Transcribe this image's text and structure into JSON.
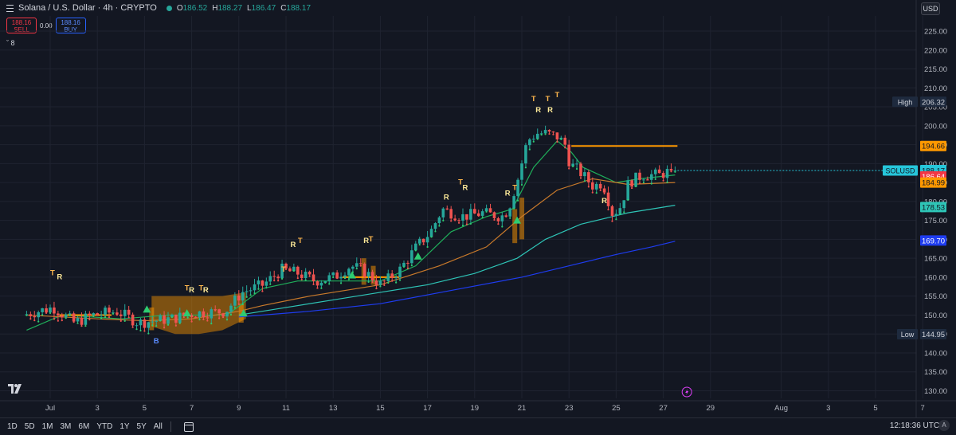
{
  "header": {
    "title": "Solana / U.S. Dollar · 4h · CRYPTO",
    "ohlc": [
      {
        "k": "O",
        "v": "186.52"
      },
      {
        "k": "H",
        "v": "188.27"
      },
      {
        "k": "L",
        "v": "186.47"
      },
      {
        "k": "C",
        "v": "188.17"
      }
    ]
  },
  "trade": {
    "sell_price": "188.16",
    "sell_label": "SELL",
    "spread": "0.00",
    "buy_price": "188.16",
    "buy_label": "BUY"
  },
  "indicator_toggle": "8",
  "currency": "USD",
  "bottombar": {
    "timeframes": [
      "1D",
      "5D",
      "1M",
      "3M",
      "6M",
      "YTD",
      "1Y",
      "5Y",
      "All"
    ],
    "clock": "12:18:36 UTC-4"
  },
  "colors": {
    "background": "#131722",
    "up": "#26a69a",
    "down": "#ef5350",
    "orange": "#ff9800",
    "teal_ma": "#2ec4b6",
    "blue_ma": "#1e3cf0",
    "green_ma": "#1fae5a",
    "highlight_green": "#2ecc71"
  },
  "chart_data": {
    "type": "candlestick",
    "yticks": [
      130,
      135,
      140,
      145,
      150,
      155,
      160,
      165,
      170,
      175,
      180,
      185,
      190,
      195,
      200,
      205,
      210,
      215,
      220,
      225
    ],
    "ylim": [
      128,
      229
    ],
    "xlim": [
      0,
      40
    ],
    "xticks": [
      {
        "label": "Jul",
        "day": 1
      },
      {
        "label": "3",
        "day": 3
      },
      {
        "label": "5",
        "day": 5
      },
      {
        "label": "7",
        "day": 7
      },
      {
        "label": "9",
        "day": 9
      },
      {
        "label": "11",
        "day": 11
      },
      {
        "label": "13",
        "day": 13
      },
      {
        "label": "15",
        "day": 15
      },
      {
        "label": "17",
        "day": 17
      },
      {
        "label": "19",
        "day": 19
      },
      {
        "label": "21",
        "day": 21
      },
      {
        "label": "23",
        "day": 23
      },
      {
        "label": "25",
        "day": 25
      },
      {
        "label": "27",
        "day": 27
      },
      {
        "label": "29",
        "day": 29
      },
      {
        "label": "Aug",
        "day": 32
      },
      {
        "label": "3",
        "day": 34
      },
      {
        "label": "5",
        "day": 36
      },
      {
        "label": "7",
        "day": 38
      }
    ],
    "price_keys": [
      [
        0,
        150
      ],
      [
        1.3,
        152
      ],
      [
        2.2,
        148
      ],
      [
        3,
        150
      ],
      [
        4,
        151
      ],
      [
        4.9,
        148
      ],
      [
        6.3,
        149
      ],
      [
        7.3,
        150.5
      ],
      [
        8.6,
        151
      ],
      [
        9.3,
        156
      ],
      [
        10.2,
        158
      ],
      [
        11,
        162
      ],
      [
        11.7,
        161
      ],
      [
        12.4,
        159
      ],
      [
        13.2,
        160
      ],
      [
        13.9,
        163
      ],
      [
        14.4,
        162
      ],
      [
        15.2,
        158
      ],
      [
        16,
        162
      ],
      [
        16.7,
        168
      ],
      [
        17.3,
        172
      ],
      [
        17.8,
        178
      ],
      [
        18.6,
        176
      ],
      [
        19.5,
        177
      ],
      [
        20.3,
        176
      ],
      [
        20.6,
        178
      ],
      [
        21,
        186
      ],
      [
        21.4,
        196
      ],
      [
        21.8,
        198
      ],
      [
        22.2,
        198
      ],
      [
        22.7,
        197
      ],
      [
        23,
        195
      ],
      [
        23.2,
        190
      ],
      [
        23.6,
        188
      ],
      [
        24.2,
        184
      ],
      [
        24.6,
        185
      ],
      [
        25,
        177
      ],
      [
        25.3,
        178
      ],
      [
        25.7,
        185
      ],
      [
        26.3,
        187
      ],
      [
        27,
        187
      ],
      [
        27.5,
        188.17
      ]
    ],
    "series_ma": [
      {
        "name": "ma-green",
        "points": [
          [
            0,
            146
          ],
          [
            1.5,
            150
          ],
          [
            4,
            149
          ],
          [
            6,
            150
          ],
          [
            8.5,
            150
          ],
          [
            10,
            157
          ],
          [
            11.5,
            159
          ],
          [
            13,
            159
          ],
          [
            15,
            159
          ],
          [
            16.5,
            163
          ],
          [
            18,
            172
          ],
          [
            19.5,
            176
          ],
          [
            20.6,
            178
          ],
          [
            21.5,
            189
          ],
          [
            22.5,
            196
          ],
          [
            23.1,
            193
          ],
          [
            23.6,
            189
          ],
          [
            24.3,
            187
          ],
          [
            25,
            185
          ],
          [
            26,
            186
          ],
          [
            27.5,
            187
          ]
        ]
      },
      {
        "name": "ma-orange",
        "points": [
          [
            0,
            150
          ],
          [
            3,
            149
          ],
          [
            5,
            148.5
          ],
          [
            7,
            149
          ],
          [
            9,
            151
          ],
          [
            10,
            152.5
          ],
          [
            12,
            155
          ],
          [
            15,
            158
          ],
          [
            17.5,
            163
          ],
          [
            19.5,
            168
          ],
          [
            21,
            176
          ],
          [
            22.5,
            183
          ],
          [
            24,
            186
          ],
          [
            25.5,
            184.5
          ],
          [
            27.5,
            185
          ]
        ]
      },
      {
        "name": "ma-teal",
        "points": [
          [
            9,
            150
          ],
          [
            11,
            152
          ],
          [
            13,
            154
          ],
          [
            15,
            156
          ],
          [
            17,
            158
          ],
          [
            19,
            161
          ],
          [
            20.8,
            165
          ],
          [
            22,
            170
          ],
          [
            23.5,
            174
          ],
          [
            25.5,
            177
          ],
          [
            27.5,
            179
          ]
        ]
      },
      {
        "name": "ma-blue",
        "points": [
          [
            9,
            149.5
          ],
          [
            12,
            151
          ],
          [
            15,
            153
          ],
          [
            18,
            156.5
          ],
          [
            21,
            160
          ],
          [
            23,
            163
          ],
          [
            25,
            166
          ],
          [
            26.5,
            168
          ],
          [
            27.5,
            169.5
          ]
        ]
      }
    ],
    "hlines": [
      {
        "name": "orange-level",
        "y": 194.66,
        "x1": 23.1,
        "x2": 27.6
      },
      {
        "name": "support-level-jul",
        "y": 150,
        "x1": 1.4,
        "x2": 3.6
      },
      {
        "name": "support-level-mid",
        "y": 160,
        "x1": 13.4,
        "x2": 15.8
      }
    ],
    "cloud": {
      "x1": 5.3,
      "x2": 9.3,
      "top": [
        [
          5.3,
          155
        ],
        [
          6.3,
          155
        ],
        [
          7.3,
          155
        ],
        [
          8.3,
          155
        ],
        [
          9.3,
          156
        ]
      ],
      "bottom": [
        [
          5.3,
          147
        ],
        [
          6.3,
          145
        ],
        [
          7.3,
          145
        ],
        [
          8.3,
          146
        ],
        [
          9.3,
          149
        ]
      ]
    },
    "markers": [
      {
        "kind": "T",
        "day": 1.1,
        "price": 160.5
      },
      {
        "kind": "R",
        "day": 1.4,
        "price": 159.5
      },
      {
        "kind": "T",
        "day": 6.8,
        "price": 156.5
      },
      {
        "kind": "R",
        "day": 7.0,
        "price": 156
      },
      {
        "kind": "T",
        "day": 7.4,
        "price": 156.5
      },
      {
        "kind": "R",
        "day": 7.6,
        "price": 156
      },
      {
        "kind": "R",
        "day": 11.3,
        "price": 168
      },
      {
        "kind": "T",
        "day": 11.6,
        "price": 169
      },
      {
        "kind": "T",
        "day": 10.9,
        "price": 161.5
      },
      {
        "kind": "R",
        "day": 14.4,
        "price": 169
      },
      {
        "kind": "T",
        "day": 14.6,
        "price": 169.5
      },
      {
        "kind": "R",
        "day": 17.8,
        "price": 180.5
      },
      {
        "kind": "T",
        "day": 18.4,
        "price": 184.5
      },
      {
        "kind": "R",
        "day": 18.6,
        "price": 183
      },
      {
        "kind": "T",
        "day": 20.7,
        "price": 183
      },
      {
        "kind": "R",
        "day": 20.4,
        "price": 181.5
      },
      {
        "kind": "R",
        "day": 21.7,
        "price": 203.5
      },
      {
        "kind": "T",
        "day": 21.5,
        "price": 206.5
      },
      {
        "kind": "T",
        "day": 22.1,
        "price": 206.5
      },
      {
        "kind": "T",
        "day": 22.5,
        "price": 207.5
      },
      {
        "kind": "R",
        "day": 22.2,
        "price": 203.5
      },
      {
        "kind": "R",
        "day": 24.5,
        "price": 179.5
      },
      {
        "kind": "B",
        "day": 5.5,
        "price": 142.5
      }
    ],
    "triangles": [
      {
        "day": 5.1,
        "price": 151.5
      },
      {
        "day": 6.8,
        "price": 150.5
      },
      {
        "day": 9.2,
        "price": 150.5
      },
      {
        "day": 13.8,
        "price": 160.5
      },
      {
        "day": 16.6,
        "price": 165.5
      },
      {
        "day": 20.8,
        "price": 175
      }
    ],
    "price_labels": [
      {
        "name": "high",
        "text": "High",
        "value": "206.32",
        "price": 206.32,
        "bg": "#1e2a3e",
        "fg": "#d1d4dc"
      },
      {
        "name": "orange-level",
        "text": "",
        "value": "194.66",
        "price": 194.66,
        "bg": "#ff9800",
        "fg": "#131722"
      },
      {
        "name": "last-price",
        "text": "SOLUSD",
        "value": "188.17",
        "sub": "05:41:23",
        "price": 188.17,
        "bg": "#26c6da",
        "fg": "#131722"
      },
      {
        "name": "red-ma",
        "text": "",
        "value": "186.64",
        "price": 186.64,
        "bg": "#f23645",
        "fg": "#ffffff"
      },
      {
        "name": "orange-ma",
        "text": "",
        "value": "184.99",
        "price": 184.99,
        "bg": "#ff9800",
        "fg": "#131722"
      },
      {
        "name": "teal-ma",
        "text": "",
        "value": "178.53",
        "price": 178.53,
        "bg": "#2ec4b6",
        "fg": "#131722"
      },
      {
        "name": "blue-ma",
        "text": "",
        "value": "169.70",
        "price": 169.7,
        "bg": "#1e3cf0",
        "fg": "#ffffff"
      },
      {
        "name": "low",
        "text": "Low",
        "value": "144.95",
        "price": 144.95,
        "bg": "#1e2a3e",
        "fg": "#d1d4dc"
      }
    ],
    "last_price": 188.17
  }
}
